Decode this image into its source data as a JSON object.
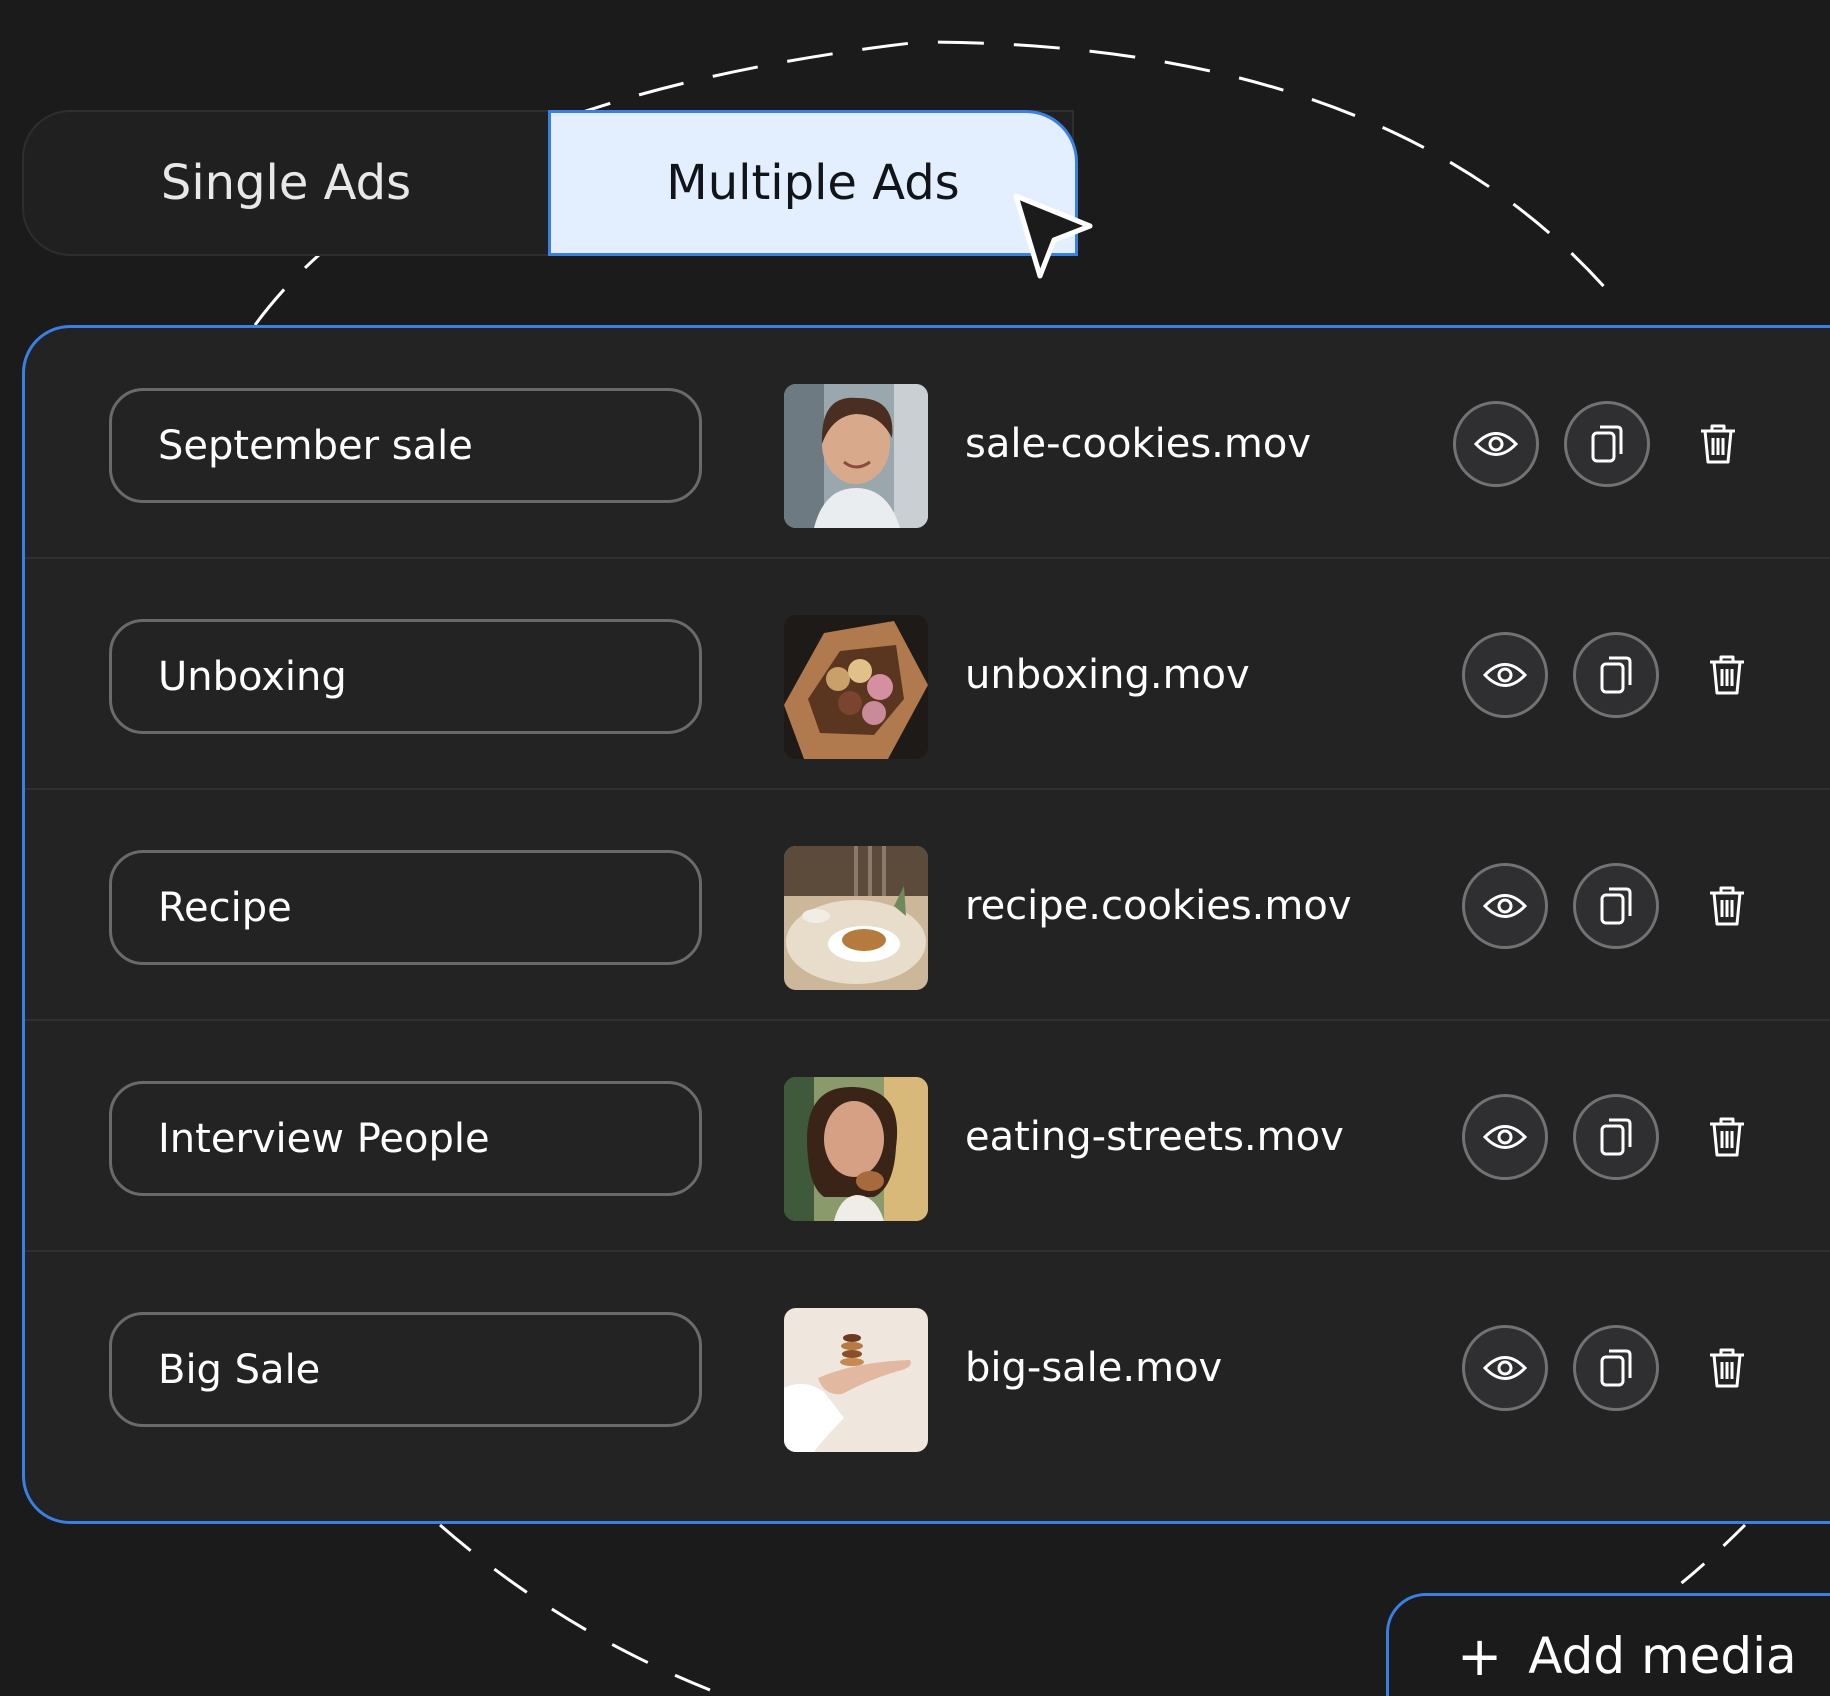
{
  "tabs": {
    "single": "Single Ads",
    "multiple": "Multiple Ads",
    "active": "multiple"
  },
  "rows": [
    {
      "name": "September sale",
      "file": "sale-cookies.mov",
      "thumb": "woman-smiling"
    },
    {
      "name": "Unboxing",
      "file": "unboxing.mov",
      "thumb": "cookie-box"
    },
    {
      "name": "Recipe",
      "file": "recipe.cookies.mov",
      "thumb": "cafe-table"
    },
    {
      "name": "Interview People",
      "file": "eating-streets.mov",
      "thumb": "woman-eating"
    },
    {
      "name": "Big Sale",
      "file": "big-sale.mov",
      "thumb": "hand-holding-cookies"
    }
  ],
  "row_actions": [
    "eye-icon",
    "copy-icon",
    "trash-icon"
  ],
  "add_media": {
    "label": "Add media",
    "icon": "plus-icon"
  },
  "colors": {
    "background": "#1b1b1c",
    "panel": "#232324",
    "accent": "#3a7fe3",
    "active_tab": "#e3efff"
  }
}
